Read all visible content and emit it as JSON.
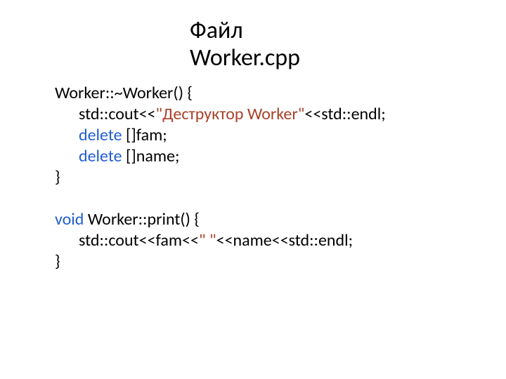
{
  "title": {
    "line1": "Файл",
    "line2": "Worker.cpp"
  },
  "code": {
    "l1a": "Worker::~Worker() {",
    "l2a": "std::cout<<",
    "l2b": "\"Деструктор Worker\"",
    "l2c": "<<std::endl;",
    "l3a": "delete",
    "l3b": " []fam;",
    "l4a": "delete",
    "l4b": " []name;",
    "l5a": "}",
    "blank": " ",
    "l7a": "void",
    "l7b": " Worker::print() {",
    "l8a": "std::cout<<fam<<",
    "l8b": "\" \"",
    "l8c": "<<name<<std::endl;",
    "l9a": "}"
  }
}
